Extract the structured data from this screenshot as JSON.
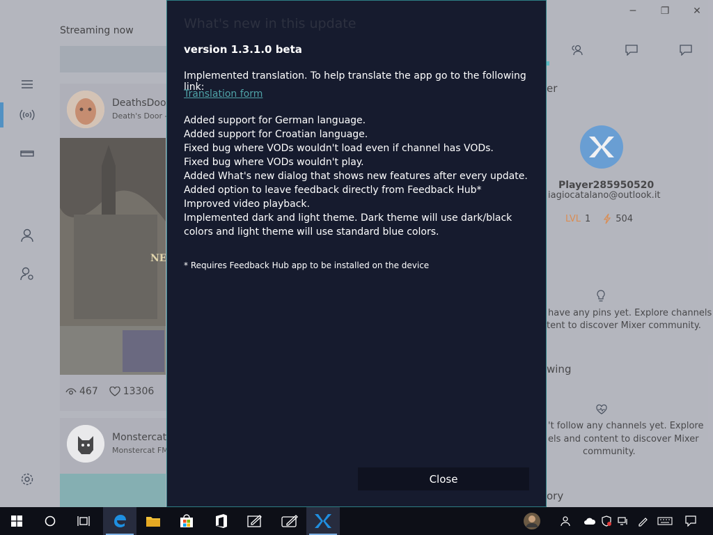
{
  "window": {
    "minimize_glyph": "─",
    "maximize_glyph": "❐",
    "close_glyph": "✕"
  },
  "streaming": {
    "title": "Streaming now",
    "cards": [
      {
        "name": "DeathsDoor",
        "sub": "Death's Door -",
        "views": "467",
        "likes": "13306",
        "thumb_text": "NE"
      },
      {
        "name": "Monstercat",
        "sub": "Monstercat FM"
      }
    ]
  },
  "profile": {
    "section_partial": "er",
    "username": "Player285950520",
    "email": "iagiocatalano@outlook.it",
    "level_label": "LVL",
    "level_value": "1",
    "sparks": "504",
    "pins_empty": [
      "have any pins yet. Explore channels",
      "tent to discover Mixer community."
    ],
    "following_heading": "wing",
    "following_empty": [
      "'t follow any channels yet. Explore",
      "els and content to discover Mixer",
      "community."
    ],
    "history_heading": "ory"
  },
  "dialog": {
    "title": "What's new in this update",
    "version": "version 1.3.1.0 beta",
    "intro": "Implemented translation. To help translate the app go to the following link:",
    "link": "Translation form",
    "items": [
      "Added support for German language.",
      "Added support for Croatian language.",
      "Fixed bug where VODs wouldn't load even if channel has VODs.",
      "Fixed bug where VODs wouldn't play.",
      "Added What's new dialog that shows new features after every update.",
      "Added option to leave feedback directly from Feedback Hub*",
      "Improved video playback.",
      "Implemented dark and light theme. Dark theme will use dark/black colors and light theme will use standard blue colors."
    ],
    "note": "* Requires Feedback Hub app to be installed on the device",
    "close_label": "Close"
  },
  "colors": {
    "dialog_bg": "#161b2e",
    "dialog_border": "#2d7f85",
    "link": "#4fa3a8",
    "taskbar": "#0d0f17",
    "accent": "#2a7fbf"
  },
  "icons": {
    "nav": [
      "hamburger-icon",
      "broadcast-icon",
      "vod-icon",
      "user-icon",
      "user-settings-icon",
      "gear-icon"
    ],
    "right_tabs": [
      "people-icon",
      "chat-icon",
      "message-icon"
    ],
    "taskbar": [
      "windows-start-icon",
      "cortana-icon",
      "task-view-icon",
      "edge-icon",
      "file-explorer-icon",
      "store-icon",
      "office-icon",
      "whiteboard-icon",
      "sketch-icon",
      "mixer-icon"
    ]
  }
}
